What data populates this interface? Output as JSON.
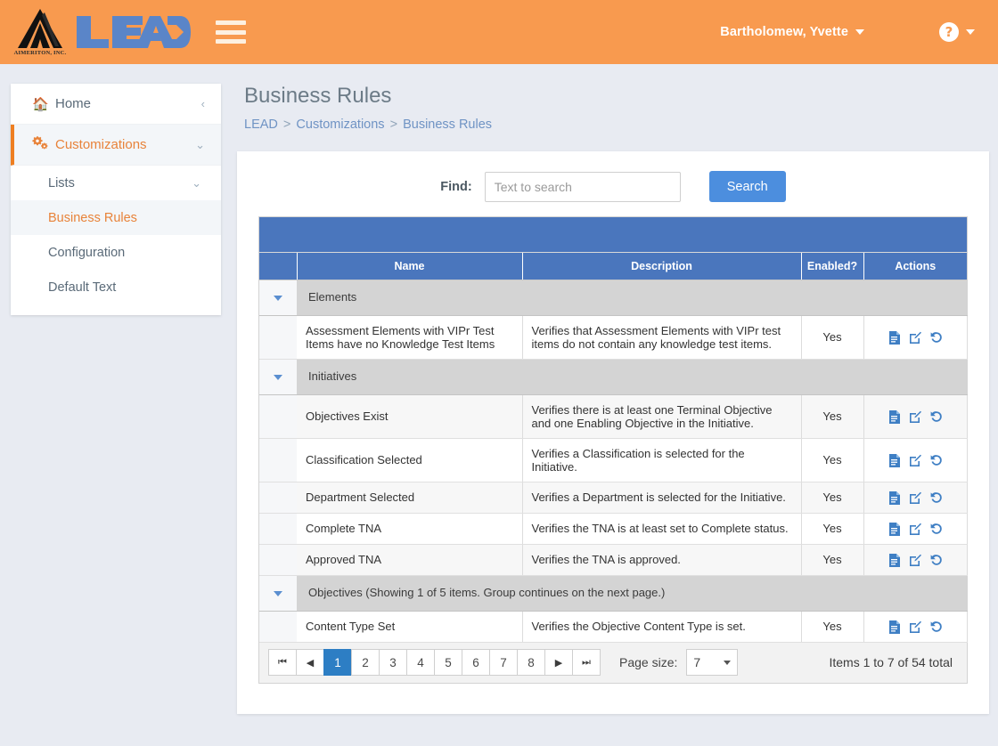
{
  "topbar": {
    "logo_corp": "AIMERITON, INC.",
    "logo_word": "LEAD",
    "menu_icon": "hamburger-icon",
    "user_name": "Bartholomew, Yvette",
    "help_icon": "question-mark-icon",
    "orange": "#f89a4f"
  },
  "sidebar": {
    "items": [
      {
        "label": "Home",
        "icon": "home-icon",
        "chevron": "‹",
        "active": false
      },
      {
        "label": "Customizations",
        "icon": "gears-icon",
        "chevron": "⌄",
        "active": true
      }
    ],
    "subitems": [
      {
        "label": "Lists",
        "chevron": "⌄",
        "selected": false
      },
      {
        "label": "Business Rules",
        "chevron": "",
        "selected": true
      },
      {
        "label": "Configuration",
        "chevron": "",
        "selected": false
      },
      {
        "label": "Default Text",
        "chevron": "",
        "selected": false
      }
    ]
  },
  "page": {
    "title": "Business Rules",
    "breadcrumb": [
      "LEAD",
      "Customizations",
      "Business Rules"
    ],
    "breadcrumb_separator": ">"
  },
  "search": {
    "find_label": "Find:",
    "placeholder": "Text to search",
    "value": "",
    "button_label": "Search",
    "button_color": "#4c8ede"
  },
  "grid": {
    "header_color": "#4a76bd",
    "columns": [
      "",
      "Name",
      "Description",
      "Enabled?",
      "Actions"
    ],
    "action_icons": [
      "document-icon",
      "edit-icon",
      "history-revert-icon"
    ],
    "groups": [
      {
        "label": "Elements",
        "rows": [
          {
            "name": "Assessment Elements with VIPr Test Items have no Knowledge Test Items",
            "description": "Verifies that Assessment Elements with VIPr test items do not contain any knowledge test items.",
            "enabled": "Yes"
          }
        ]
      },
      {
        "label": "Initiatives",
        "rows": [
          {
            "name": "Objectives Exist",
            "description": "Verifies there is at least one Terminal Objective and one Enabling Objective in the Initiative.",
            "enabled": "Yes"
          },
          {
            "name": "Classification Selected",
            "description": "Verifies a Classification is selected for the Initiative.",
            "enabled": "Yes"
          },
          {
            "name": "Department Selected",
            "description": "Verifies a Department is selected for the Initiative.",
            "enabled": "Yes"
          },
          {
            "name": "Complete TNA",
            "description": "Verifies the TNA is at least set to Complete status.",
            "enabled": "Yes"
          },
          {
            "name": "Approved TNA",
            "description": "Verifies the TNA is approved.",
            "enabled": "Yes"
          }
        ]
      },
      {
        "label": "Objectives (Showing 1 of 5 items. Group continues on the next page.)",
        "rows": [
          {
            "name": "Content Type Set",
            "description": "Verifies the Objective Content Type is set.",
            "enabled": "Yes"
          }
        ]
      }
    ]
  },
  "pager": {
    "first_glyph": "❘◄",
    "prev_glyph": "◄",
    "next_glyph": "►",
    "last_glyph": "►❘",
    "pages": [
      "1",
      "2",
      "3",
      "4",
      "5",
      "6",
      "7",
      "8"
    ],
    "current_page": "1",
    "page_size_label": "Page size:",
    "page_size_value": "7",
    "info": "Items 1 to 7 of 54 total"
  }
}
